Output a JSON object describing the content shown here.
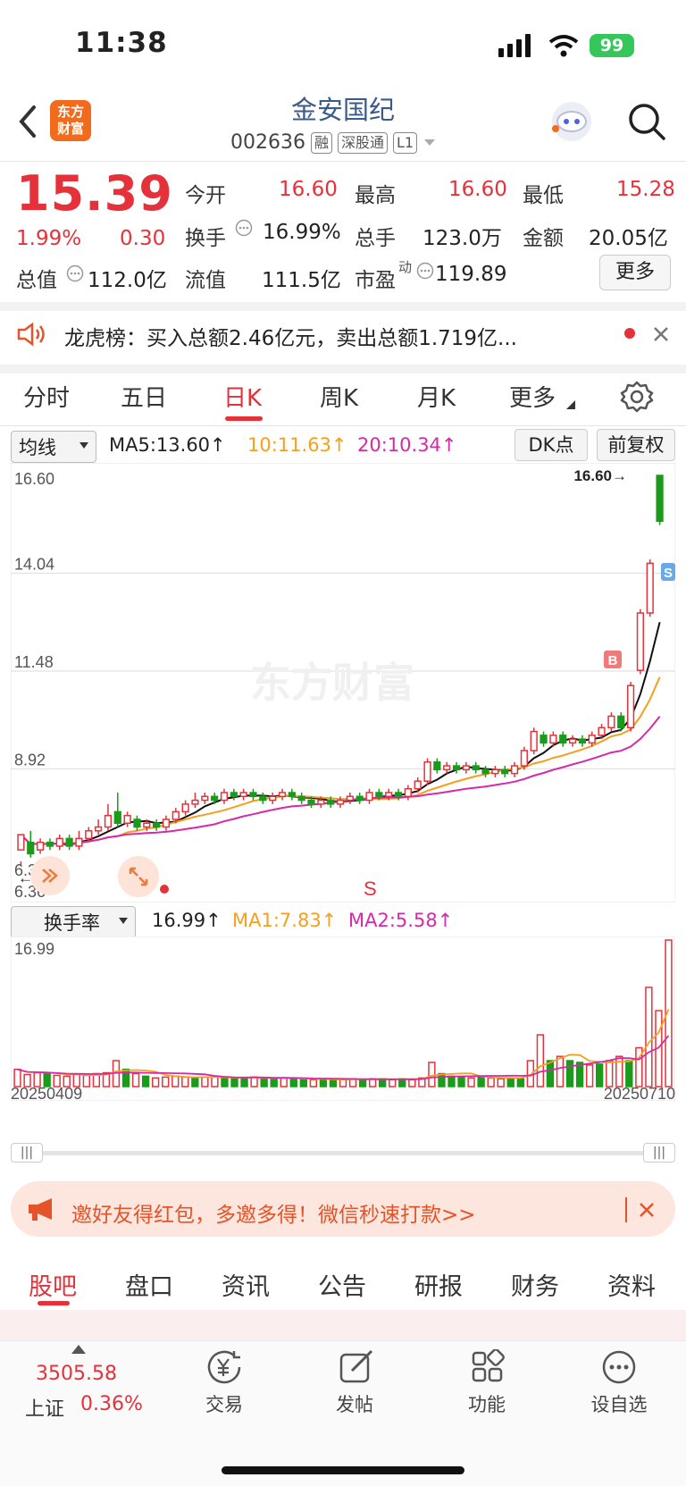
{
  "status": {
    "time": "11:38",
    "battery": "99"
  },
  "header": {
    "title": "金安国纪",
    "code": "002636",
    "tags": [
      "融",
      "深股通",
      "L1"
    ],
    "logo_line1": "东方",
    "logo_line2": "财富"
  },
  "quote": {
    "price": "15.39",
    "change_pct": "1.99%",
    "change_amt": "0.30",
    "open_label": "今开",
    "open": "16.60",
    "high_label": "最高",
    "high": "16.60",
    "low_label": "最低",
    "low": "15.28",
    "turnover_label": "换手",
    "turnover": "16.99%",
    "volume_label": "总手",
    "volume": "123.0万",
    "amount_label": "金额",
    "amount": "20.05亿",
    "mktcap_label": "总值",
    "mktcap": "112.0亿",
    "float_label": "流值",
    "float": "111.5亿",
    "pe_label": "市盈",
    "pe_sup": "动",
    "pe": "119.89",
    "more_label": "更多"
  },
  "news": {
    "text": "龙虎榜：买入总额2.46亿元，卖出总额1.719亿..."
  },
  "kline_tabs": [
    "分时",
    "五日",
    "日K",
    "周K",
    "月K",
    "更多"
  ],
  "kline_active": "日K",
  "ma_row": {
    "select": "均线",
    "ma5": "MA5:13.60↑",
    "ma10": "10:11.63↑",
    "ma20": "20:10.34↑",
    "dk": "DK点",
    "fq": "前复权"
  },
  "watermark": "东方财富",
  "turnover_row": {
    "select": "换手率",
    "value": "16.99↑",
    "ma1": "MA1:7.83↑",
    "ma2": "MA2:5.58↑"
  },
  "chart_data": [
    {
      "type": "candlestick",
      "y_ticks": [
        "16.60",
        "14.04",
        "11.48",
        "8.92",
        "6.36"
      ],
      "ylim": [
        6.36,
        16.6
      ],
      "high_marker": "16.60→",
      "low_marker": "←6.36",
      "signal_marks": [
        "S",
        "B"
      ],
      "series": [
        {
          "name": "MA5",
          "color": "#111111"
        },
        {
          "name": "MA10",
          "color": "#f4a01e"
        },
        {
          "name": "MA20",
          "color": "#d42aa8"
        }
      ],
      "candles": [
        [
          6.8,
          7.2,
          6.5,
          6.4
        ],
        [
          7.0,
          6.7,
          7.3,
          6.6
        ],
        [
          6.8,
          7.0,
          7.1,
          6.7
        ],
        [
          7.0,
          6.9,
          7.1,
          6.8
        ],
        [
          6.9,
          7.1,
          7.2,
          6.8
        ],
        [
          7.1,
          6.9,
          7.2,
          6.8
        ],
        [
          6.9,
          7.1,
          7.3,
          6.8
        ],
        [
          7.1,
          7.3,
          7.4,
          7.0
        ],
        [
          7.3,
          7.4,
          7.6,
          7.2
        ],
        [
          7.4,
          7.7,
          8.0,
          7.3
        ],
        [
          7.8,
          7.5,
          8.3,
          7.4
        ],
        [
          7.5,
          7.7,
          7.8,
          7.4
        ],
        [
          7.6,
          7.4,
          7.7,
          7.3
        ],
        [
          7.4,
          7.5,
          7.6,
          7.3
        ],
        [
          7.5,
          7.4,
          7.6,
          7.3
        ],
        [
          7.4,
          7.6,
          7.7,
          7.3
        ],
        [
          7.6,
          7.8,
          7.9,
          7.5
        ],
        [
          7.8,
          8.0,
          8.1,
          7.7
        ],
        [
          8.0,
          8.1,
          8.3,
          7.9
        ],
        [
          8.1,
          8.2,
          8.3,
          8.0
        ],
        [
          8.2,
          8.1,
          8.3,
          8.0
        ],
        [
          8.1,
          8.3,
          8.4,
          8.0
        ],
        [
          8.3,
          8.2,
          8.4,
          8.1
        ],
        [
          8.2,
          8.3,
          8.4,
          8.1
        ],
        [
          8.3,
          8.2,
          8.4,
          8.1
        ],
        [
          8.2,
          8.1,
          8.3,
          8.0
        ],
        [
          8.1,
          8.2,
          8.3,
          8.0
        ],
        [
          8.2,
          8.3,
          8.4,
          8.1
        ],
        [
          8.3,
          8.2,
          8.4,
          8.1
        ],
        [
          8.2,
          8.1,
          8.3,
          8.0
        ],
        [
          8.1,
          8.0,
          8.2,
          7.9
        ],
        [
          8.0,
          8.1,
          8.2,
          7.9
        ],
        [
          8.1,
          8.0,
          8.2,
          7.9
        ],
        [
          8.0,
          8.1,
          8.2,
          7.9
        ],
        [
          8.1,
          8.2,
          8.3,
          8.0
        ],
        [
          8.2,
          8.1,
          8.3,
          8.0
        ],
        [
          8.1,
          8.3,
          8.4,
          8.0
        ],
        [
          8.3,
          8.2,
          8.4,
          8.1
        ],
        [
          8.2,
          8.3,
          8.4,
          8.1
        ],
        [
          8.3,
          8.2,
          8.4,
          8.1
        ],
        [
          8.2,
          8.4,
          8.5,
          8.1
        ],
        [
          8.4,
          8.6,
          8.7,
          8.3
        ],
        [
          8.6,
          9.1,
          9.2,
          8.5
        ],
        [
          9.1,
          8.9,
          9.2,
          8.8
        ],
        [
          8.9,
          9.0,
          9.1,
          8.8
        ],
        [
          9.0,
          8.9,
          9.1,
          8.8
        ],
        [
          8.9,
          9.0,
          9.1,
          8.8
        ],
        [
          9.0,
          8.9,
          9.1,
          8.8
        ],
        [
          8.9,
          8.8,
          9.0,
          8.7
        ],
        [
          8.8,
          8.9,
          9.0,
          8.7
        ],
        [
          8.9,
          8.8,
          9.0,
          8.7
        ],
        [
          8.8,
          9.0,
          9.1,
          8.7
        ],
        [
          9.0,
          9.4,
          9.5,
          8.9
        ],
        [
          9.4,
          9.9,
          10.0,
          9.3
        ],
        [
          9.8,
          9.6,
          9.9,
          9.5
        ],
        [
          9.6,
          9.8,
          9.9,
          9.5
        ],
        [
          9.8,
          9.6,
          9.9,
          9.5
        ],
        [
          9.6,
          9.7,
          9.8,
          9.5
        ],
        [
          9.7,
          9.6,
          9.8,
          9.5
        ],
        [
          9.6,
          9.8,
          9.9,
          9.5
        ],
        [
          9.8,
          10.0,
          10.1,
          9.7
        ],
        [
          10.0,
          10.3,
          10.4,
          9.9
        ],
        [
          10.3,
          10.0,
          10.4,
          9.9
        ],
        [
          10.0,
          11.1,
          11.2,
          9.9
        ],
        [
          11.5,
          13.0,
          13.1,
          11.4
        ],
        [
          13.0,
          14.3,
          14.4,
          12.9
        ],
        [
          16.6,
          15.4,
          16.6,
          15.3
        ]
      ]
    },
    {
      "type": "bar",
      "title": "换手率",
      "y_ticks": [
        "16.99"
      ],
      "ylim": [
        0,
        16.99
      ],
      "x_labels": [
        "20250409",
        "20250710"
      ],
      "series": [
        {
          "name": "MA1",
          "color": "#f4a01e"
        },
        {
          "name": "MA2",
          "color": "#d42aa8"
        }
      ],
      "values": [
        2.0,
        1.4,
        1.6,
        1.5,
        1.3,
        1.2,
        1.4,
        1.3,
        1.5,
        1.6,
        3.0,
        2.0,
        1.5,
        1.2,
        1.0,
        1.1,
        1.2,
        1.1,
        1.0,
        1.1,
        1.2,
        1.0,
        0.9,
        1.0,
        1.1,
        1.0,
        0.9,
        1.0,
        0.9,
        0.8,
        0.8,
        0.9,
        0.8,
        0.8,
        0.9,
        0.8,
        0.9,
        0.9,
        0.8,
        0.9,
        0.8,
        1.0,
        2.8,
        1.5,
        1.2,
        1.1,
        1.0,
        1.1,
        1.0,
        0.9,
        1.0,
        0.9,
        3.0,
        6.0,
        3.0,
        3.5,
        3.0,
        2.8,
        2.5,
        2.6,
        3.0,
        3.5,
        3.0,
        4.5,
        11.5,
        8.8,
        16.99
      ],
      "colors_up": [
        true,
        true,
        true,
        false,
        true,
        true,
        true,
        true,
        true,
        true,
        true,
        false,
        true,
        false,
        true,
        true,
        true,
        true,
        false,
        true,
        true,
        false,
        false,
        false,
        true,
        false,
        false,
        true,
        false,
        false,
        true,
        false,
        false,
        true,
        true,
        false,
        true,
        false,
        true,
        false,
        true,
        true,
        true,
        false,
        false,
        false,
        true,
        false,
        true,
        true,
        false,
        false,
        true,
        true,
        false,
        true,
        false,
        false,
        true,
        false,
        true,
        true,
        false,
        true,
        true,
        true,
        true
      ]
    }
  ],
  "promo": {
    "text": "邀好友得红包，多邀多得！微信秒速打款>>"
  },
  "bottom_tabs": [
    "股吧",
    "盘口",
    "资讯",
    "公告",
    "研报",
    "财务",
    "资料"
  ],
  "bottom_active": "股吧",
  "bottom_nav": {
    "index_value": "3505.58",
    "index_name": "上证",
    "index_change": "0.36%",
    "trade": "交易",
    "post": "发帖",
    "functions": "功能",
    "watchlist": "设自选"
  }
}
